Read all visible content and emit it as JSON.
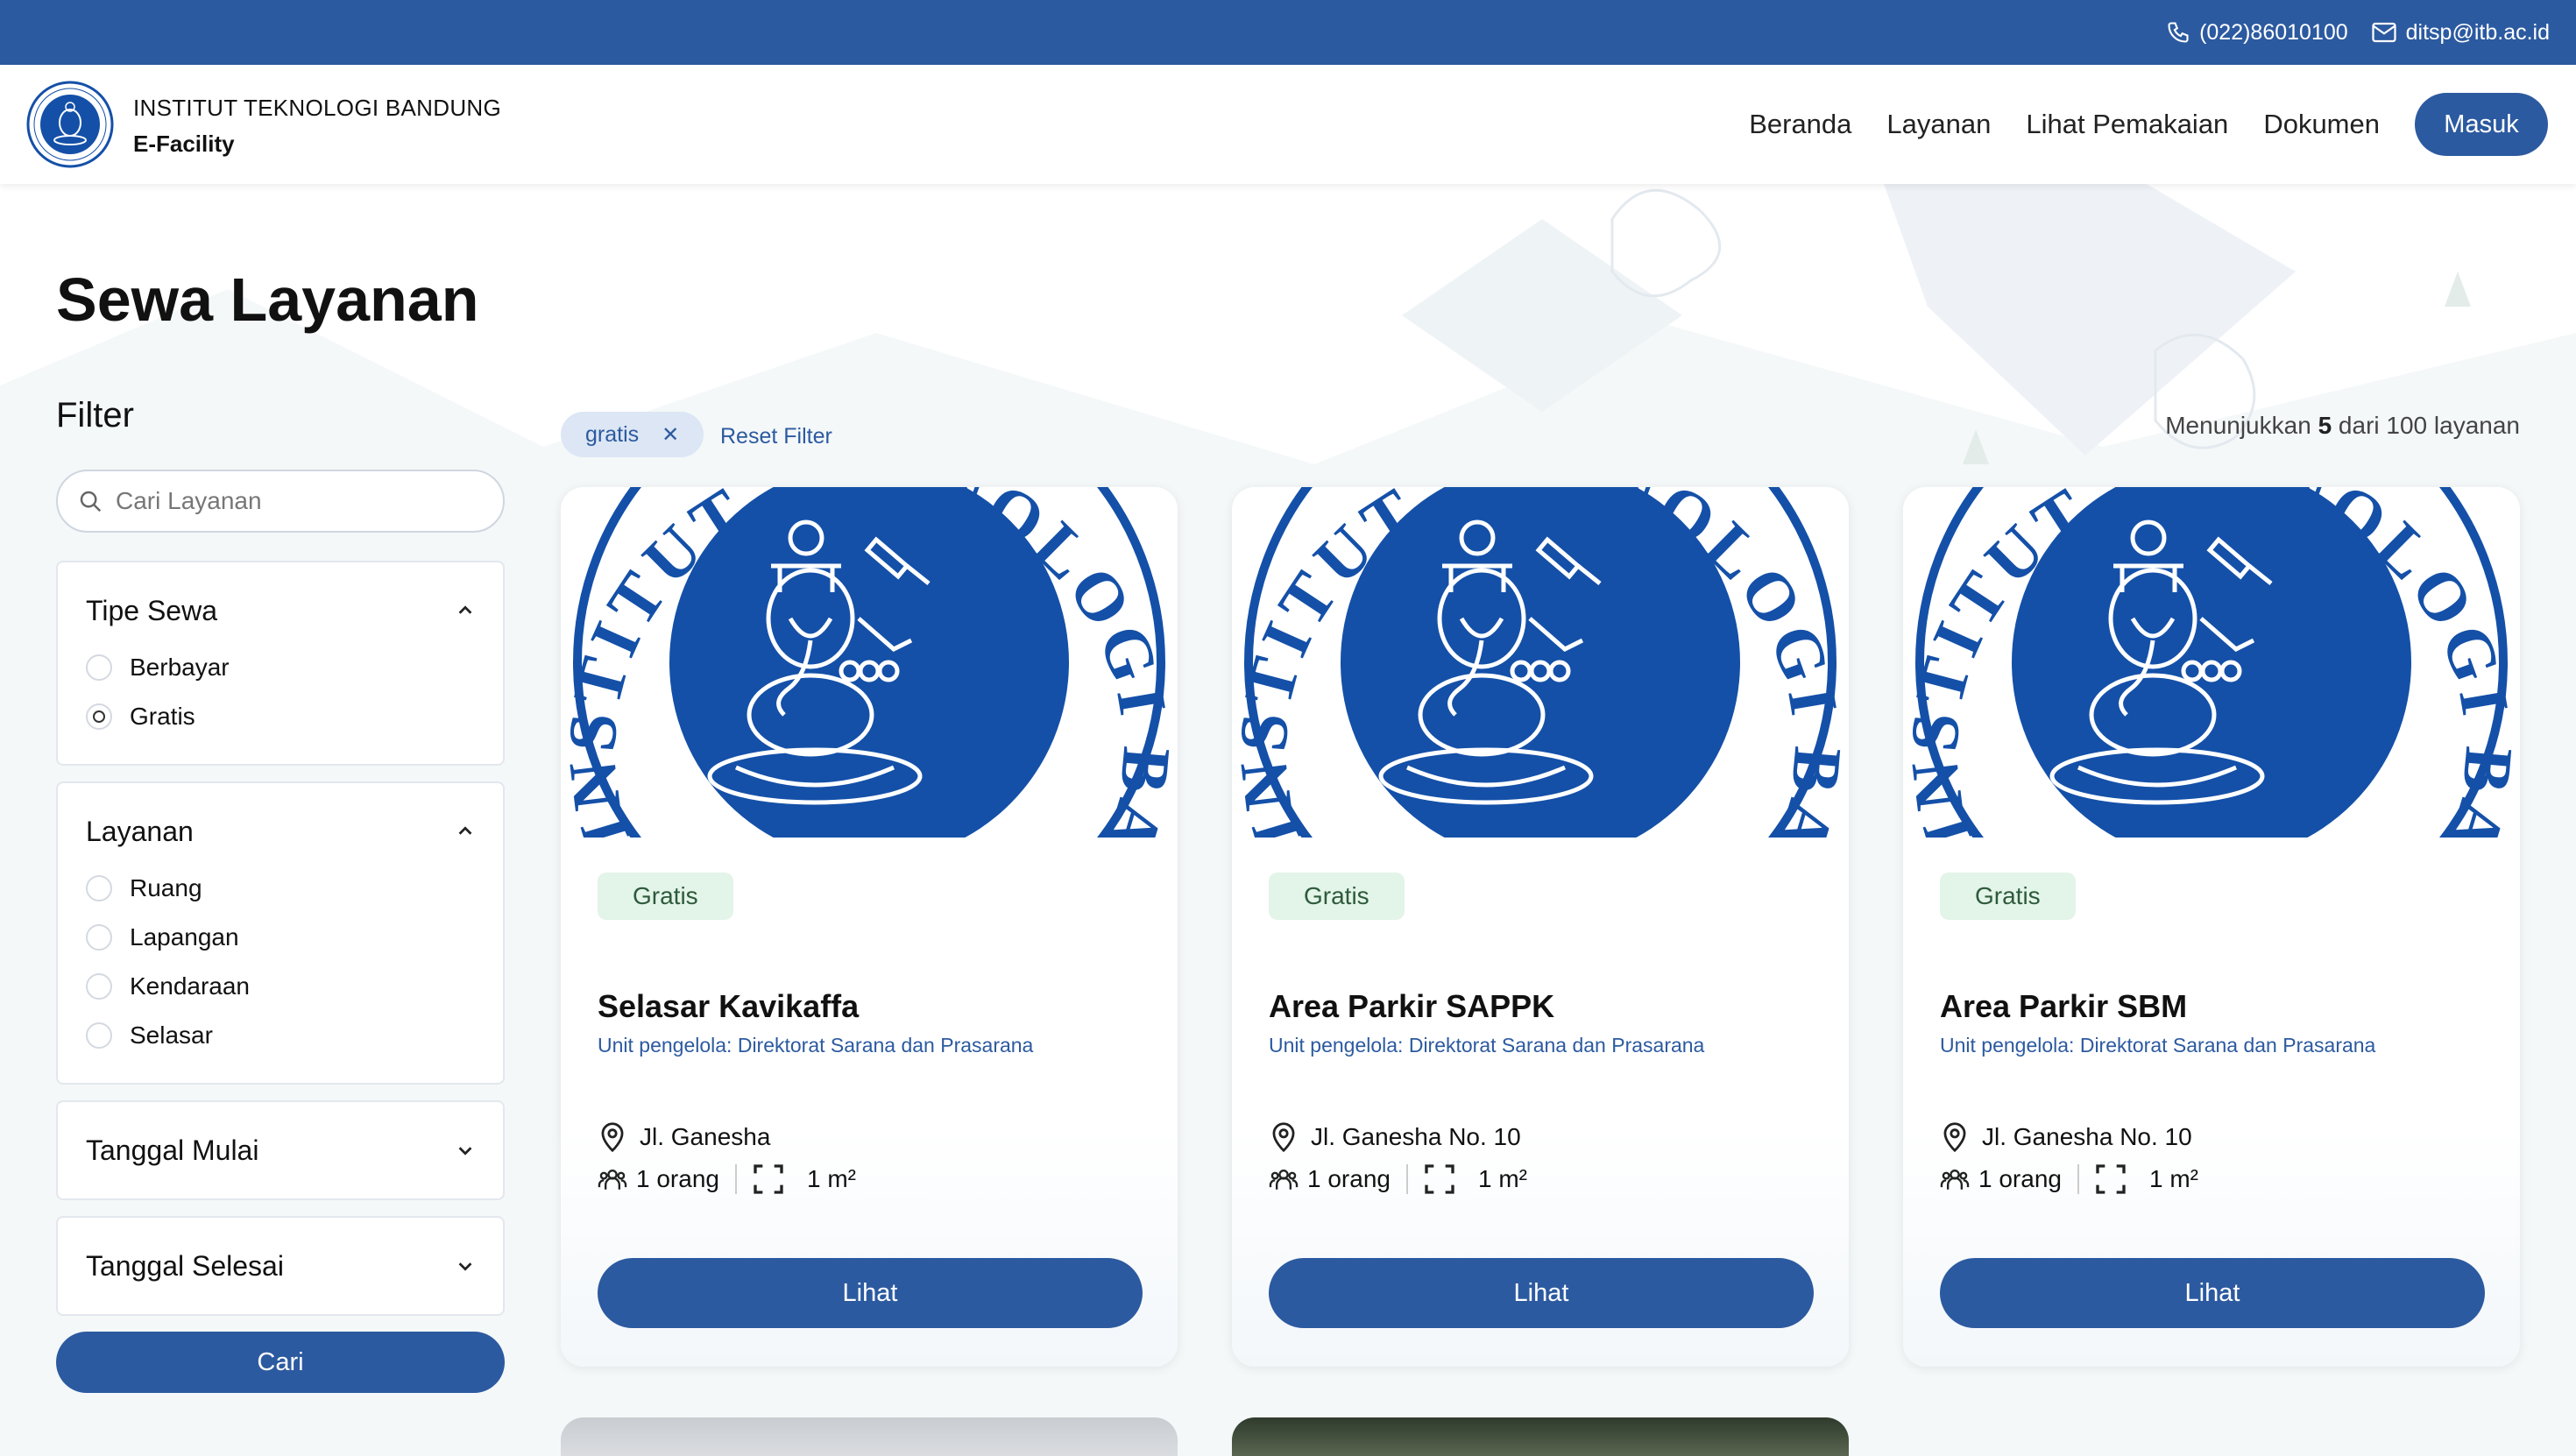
{
  "topbar": {
    "phone": "(022)86010100",
    "email": "ditsp@itb.ac.id"
  },
  "header": {
    "institution": "INSTITUT TEKNOLOGI BANDUNG",
    "app_name": "E-Facility",
    "nav": [
      "Beranda",
      "Layanan",
      "Lihat Pemakaian",
      "Dokumen"
    ],
    "login_label": "Masuk"
  },
  "page": {
    "title": "Sewa Layanan"
  },
  "filter": {
    "title": "Filter",
    "search_placeholder": "Cari Layanan",
    "tipe_sewa": {
      "title": "Tipe Sewa",
      "options": [
        "Berbayar",
        "Gratis"
      ],
      "selected": "Gratis"
    },
    "layanan": {
      "title": "Layanan",
      "options": [
        "Ruang",
        "Lapangan",
        "Kendaraan",
        "Selasar"
      ]
    },
    "tanggal_mulai": {
      "title": "Tanggal Mulai"
    },
    "tanggal_selesai": {
      "title": "Tanggal Selesai"
    },
    "search_button": "Cari"
  },
  "active_filters": {
    "chip_label": "gratis",
    "reset_label": "Reset Filter"
  },
  "results": {
    "prefix": "Menunjukkan",
    "shown": "5",
    "middle": "dari",
    "total": "100",
    "suffix": "layanan"
  },
  "cards": [
    {
      "badge": "Gratis",
      "title": "Selasar Kavikaffa",
      "unit": "Unit pengelola: Direktorat Sarana dan Prasarana",
      "location": "Jl. Ganesha",
      "capacity": "1 orang",
      "area": "1 m²",
      "button": "Lihat"
    },
    {
      "badge": "Gratis",
      "title": "Area Parkir SAPPK",
      "unit": "Unit pengelola: Direktorat Sarana dan Prasarana",
      "location": "Jl. Ganesha No. 10",
      "capacity": "1 orang",
      "area": "1 m²",
      "button": "Lihat"
    },
    {
      "badge": "Gratis",
      "title": "Area Parkir SBM",
      "unit": "Unit pengelola: Direktorat Sarana dan Prasarana",
      "location": "Jl. Ganesha No. 10",
      "capacity": "1 orang",
      "area": "1 m²",
      "button": "Lihat"
    }
  ],
  "logo_seal_text": "INSTITUT TEKNOLOGI BANDUNG",
  "colors": {
    "primary": "#2c5aa0",
    "logo_blue": "#1450a8",
    "badge_bg": "#e3f4e8"
  }
}
